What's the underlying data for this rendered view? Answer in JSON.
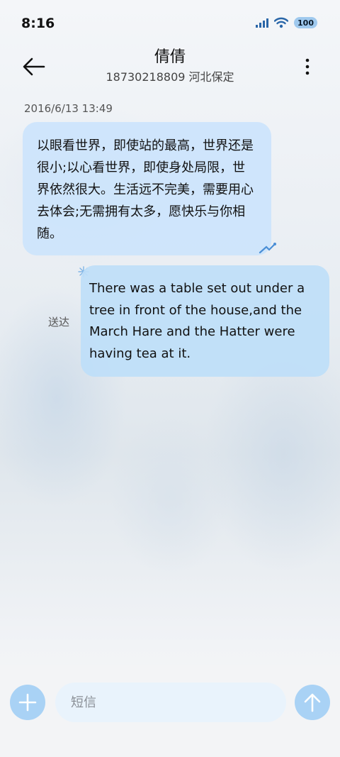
{
  "status_bar": {
    "time": "8:16",
    "battery": "100",
    "icons": [
      "signal-icon",
      "wifi-icon",
      "battery-icon"
    ]
  },
  "header": {
    "name": "倩倩",
    "subtitle": "18730218809 河北保定",
    "back_icon": "arrow-left-icon",
    "more_icon": "more-vertical-icon"
  },
  "conversation": {
    "timestamp": "2016/6/13 13:49",
    "messages": [
      {
        "direction": "incoming",
        "text": "以眼看世界，即使站的最高，世界还是很小;以心看世界，即使身处局限，世界依然很大。生活远不完美，需要用心去体会;无需拥有太多，愿快乐与你相随。"
      },
      {
        "direction": "outgoing",
        "text": "There was a table set out under a tree in front of the house,and the March Hare and the Hatter were having tea at it.",
        "status": "送达"
      }
    ]
  },
  "composer": {
    "placeholder": "短信",
    "value": "",
    "add_icon": "plus-icon",
    "send_icon": "arrow-up-icon"
  },
  "colors": {
    "incoming_bubble": "#cce4fc",
    "outgoing_bubble": "#bedef8",
    "accent": "#a9d2f5"
  }
}
